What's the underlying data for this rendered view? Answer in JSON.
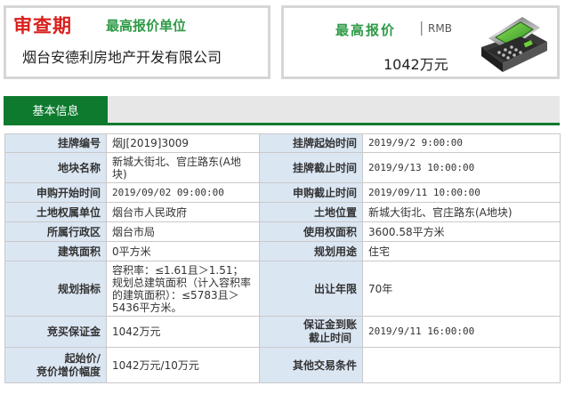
{
  "header": {
    "status_badge": "审查期",
    "bidder_title": "最高报价单位",
    "bidder_name": "烟台安德利房地产开发有限公司",
    "price_title": "最高报价",
    "price_separator": "|",
    "price_unit": "RMB",
    "price_value": "1042万元",
    "icon": "auction-machine-icon"
  },
  "tabs": [
    {
      "label": "基本信息",
      "active": true
    }
  ],
  "colors": {
    "accent_green": "#0d7a2e",
    "title_green": "#2d9a46",
    "status_red": "#d8201c",
    "label_red": "#c21818",
    "label_bg": "#dbe6f3"
  },
  "info": {
    "rows": [
      {
        "l1": "挂牌编号",
        "v1": "烟J[2019]3009",
        "l2": "挂牌起始时间",
        "v2": "2019/9/2 9:00:00"
      },
      {
        "l1": "地块名称",
        "v1": "新城大街北、官庄路东(A地块)",
        "l2": "挂牌截止时间",
        "v2": "2019/9/13 10:00:00"
      },
      {
        "l1": "申购开始时间",
        "v1": "2019/09/02 09:00:00",
        "l2": "申购截止时间",
        "v2": "2019/09/11 10:00:00"
      },
      {
        "l1": "土地权属单位",
        "v1": "烟台市人民政府",
        "l2": "土地位置",
        "v2": "新城大街北、官庄路东(A地块)"
      },
      {
        "l1": "所属行政区",
        "v1": "烟台市局",
        "l2": "使用权面积",
        "v2": "3600.58平方米"
      },
      {
        "l1": "建筑面积",
        "v1": "0平方米",
        "l2": "规划用途",
        "v2": "住宅"
      },
      {
        "l1": "规划指标",
        "v1": "容积率：≤1.61且＞1.51；规划总建筑面积（计入容积率的建筑面积）：≤5783且＞5436平方米。",
        "l2": "出让年限",
        "v2": "70年"
      },
      {
        "l1": "竞买保证金",
        "v1": "1042万元",
        "l2a": "保证金到账",
        "l2b": "截止时间",
        "v2": "2019/9/11 16:00:00"
      },
      {
        "l1a": "起始价/",
        "l1b": "竞价增价幅度",
        "v1": "1042万元/10万元",
        "l2": "其他交易条件",
        "v2": ""
      }
    ]
  }
}
